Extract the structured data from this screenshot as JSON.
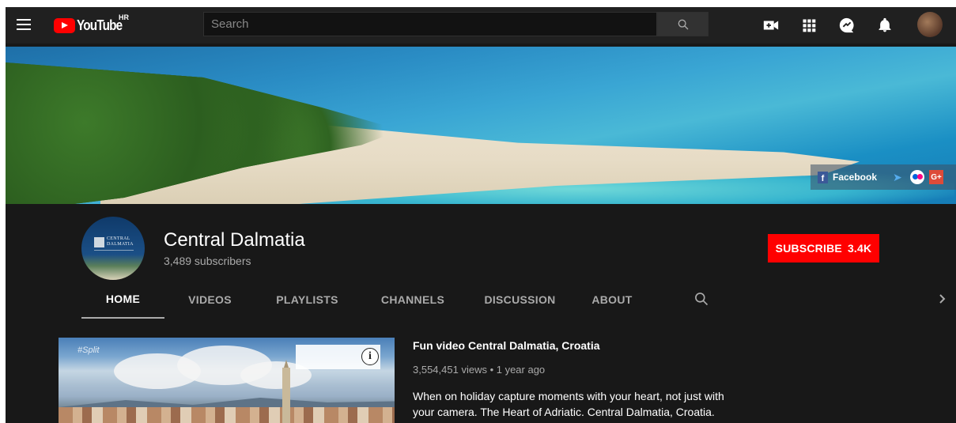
{
  "header": {
    "logo_text": "YouTube",
    "country_code": "HR",
    "search_placeholder": "Search",
    "icons": [
      "menu-icon",
      "create-video-icon",
      "apps-icon",
      "messages-icon",
      "notifications-icon",
      "account-avatar"
    ]
  },
  "banner": {
    "social_links": [
      {
        "label": "Facebook",
        "icon": "facebook-icon"
      },
      {
        "label": "",
        "icon": "twitter-icon"
      },
      {
        "label": "",
        "icon": "flickr-icon"
      },
      {
        "label": "G+",
        "icon": "google-plus-icon"
      }
    ]
  },
  "channel": {
    "name": "Central Dalmatia",
    "subscribers": "3,489 subscribers",
    "avatar_text": "CENTRAL DALMATIA",
    "subscribe_label": "SUBSCRIBE",
    "subscribe_count": "3.4K",
    "subscribe_color": "#ff0000"
  },
  "tabs": [
    {
      "label": "HOME",
      "active": true
    },
    {
      "label": "VIDEOS",
      "active": false
    },
    {
      "label": "PLAYLISTS",
      "active": false
    },
    {
      "label": "CHANNELS",
      "active": false
    },
    {
      "label": "DISCUSSION",
      "active": false
    },
    {
      "label": "ABOUT",
      "active": false
    }
  ],
  "featured_video": {
    "hashtag": "#Split",
    "title": "Fun video Central Dalmatia, Croatia",
    "views": "3,554,451 views",
    "age": "1 year ago",
    "meta": "3,554,451 views • 1 year ago",
    "description": "When on holiday capture moments with your heart, not just with your camera. The Heart of Adriatic. Central Dalmatia, Croatia."
  }
}
